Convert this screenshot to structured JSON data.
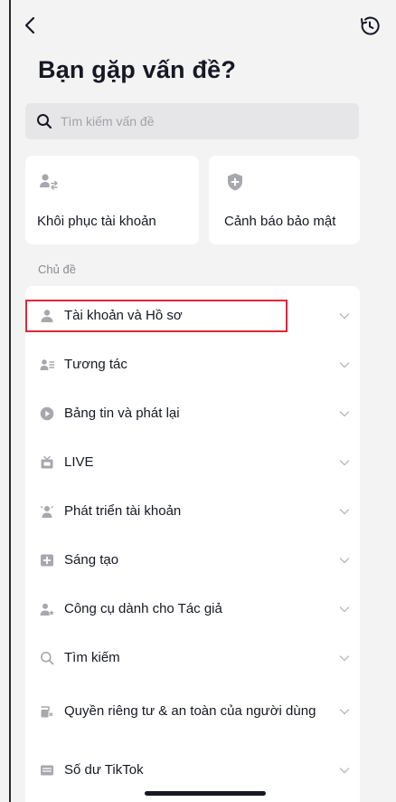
{
  "header": {
    "back_icon": "chevron-left-icon",
    "history_icon": "clock-history-icon",
    "title": "Bạn gặp vấn đề?"
  },
  "search": {
    "placeholder": "Tìm kiếm vấn đề",
    "icon": "search-icon"
  },
  "cards": [
    {
      "label": "Khôi phục tài khoản",
      "icon": "user-swap-icon"
    },
    {
      "label": "Cảnh báo bảo mật",
      "icon": "shield-plus-icon"
    }
  ],
  "section": {
    "label": "Chủ đề"
  },
  "topics": [
    {
      "label": "Tài khoản và Hồ sơ",
      "icon": "person-icon",
      "highlighted": true
    },
    {
      "label": "Tương tác",
      "icon": "people-icon"
    },
    {
      "label": "Bảng tin và phát lại",
      "icon": "play-circle-icon"
    },
    {
      "label": "LIVE",
      "icon": "live-tv-icon"
    },
    {
      "label": "Phát triển tài khoản",
      "icon": "person-growth-icon"
    },
    {
      "label": "Sáng tạo",
      "icon": "create-plus-icon"
    },
    {
      "label": "Công cụ dành cho Tác giả",
      "icon": "creator-tools-icon"
    },
    {
      "label": "Tìm kiếm",
      "icon": "search-icon"
    },
    {
      "label": "Quyền riêng tư & an toàn của người dùng",
      "icon": "privacy-icon"
    },
    {
      "label": "Số dư TikTok",
      "icon": "wallet-icon"
    }
  ],
  "colors": {
    "highlight_border": "#e0263a",
    "icon_gray": "#a7a8ad",
    "background": "#f3f3f4"
  }
}
